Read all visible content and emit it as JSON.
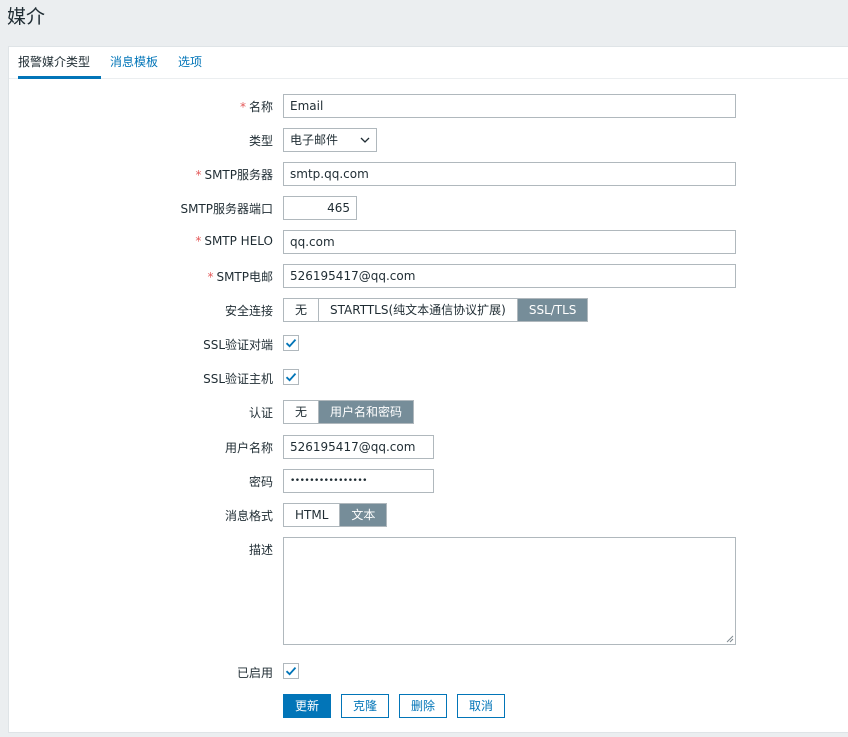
{
  "page": {
    "title": "媒介"
  },
  "tabs": [
    {
      "label": "报警媒介类型"
    },
    {
      "label": "消息模板"
    },
    {
      "label": "选项"
    }
  ],
  "form": {
    "name": {
      "label": "名称",
      "value": "Email"
    },
    "type": {
      "label": "类型",
      "value": "电子邮件"
    },
    "smtp_server": {
      "label": "SMTP服务器",
      "value": "smtp.qq.com"
    },
    "smtp_port": {
      "label": "SMTP服务器端口",
      "value": "465"
    },
    "smtp_helo": {
      "label": "SMTP HELO",
      "value": "qq.com"
    },
    "smtp_email": {
      "label": "SMTP电邮",
      "value": "526195417@qq.com"
    },
    "security": {
      "label": "安全连接",
      "options": [
        "无",
        "STARTTLS(纯文本通信协议扩展)",
        "SSL/TLS"
      ],
      "selected": "SSL/TLS"
    },
    "ssl_verify_peer": {
      "label": "SSL验证对端",
      "checked": true
    },
    "ssl_verify_host": {
      "label": "SSL验证主机",
      "checked": true
    },
    "auth": {
      "label": "认证",
      "options": [
        "无",
        "用户名和密码"
      ],
      "selected": "用户名和密码"
    },
    "username": {
      "label": "用户名称",
      "value": "526195417@qq.com"
    },
    "password": {
      "label": "密码",
      "value": "••••••••••••••••"
    },
    "message_format": {
      "label": "消息格式",
      "options": [
        "HTML",
        "文本"
      ],
      "selected": "文本"
    },
    "description": {
      "label": "描述",
      "value": ""
    },
    "enabled": {
      "label": "已启用",
      "checked": true
    }
  },
  "buttons": {
    "update": "更新",
    "clone": "克隆",
    "delete": "删除",
    "cancel": "取消"
  },
  "colors": {
    "accent": "#0275b8",
    "required": "#e45959",
    "segment_selected": "#768d99"
  },
  "required_marker": "*"
}
